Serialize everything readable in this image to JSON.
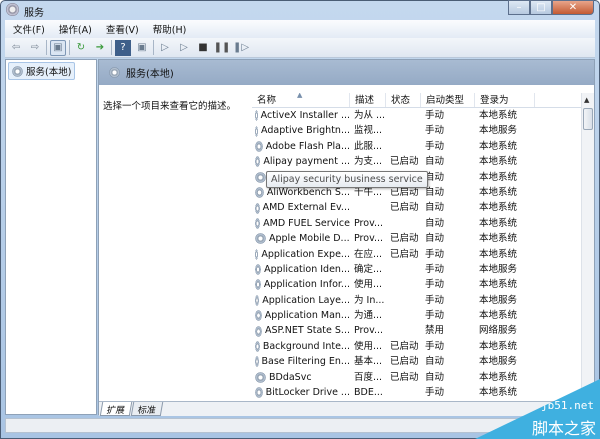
{
  "window": {
    "title": "服务",
    "controls": [
      "minimize",
      "maximize",
      "close"
    ]
  },
  "menu": [
    "文件(F)",
    "操作(A)",
    "查看(V)",
    "帮助(H)"
  ],
  "toolbar": [
    "back-icon",
    "forward-icon",
    "console-tree-icon",
    "refresh-icon",
    "export-icon",
    "help-icon",
    "properties-icon",
    "start-icon",
    "start-alt-icon",
    "stop-icon",
    "pause-icon",
    "restart-icon"
  ],
  "tree": {
    "root": "服务(本地)"
  },
  "panel": {
    "title": "服务(本地)",
    "description": "选择一个项目来查看它的描述。"
  },
  "columns": [
    "名称",
    "描述",
    "状态",
    "启动类型",
    "登录为"
  ],
  "rows": [
    [
      "ActiveX Installer ...",
      "为从 ...",
      "",
      "手动",
      "本地系统"
    ],
    [
      "Adaptive Brightn...",
      "监视...",
      "",
      "手动",
      "本地服务"
    ],
    [
      "Adobe Flash Pla...",
      "此服...",
      "",
      "手动",
      "本地系统"
    ],
    [
      "Alipay payment ...",
      "为支...",
      "已启动",
      "自动",
      "本地系统"
    ],
    [
      "",
      "",
      "已启动",
      "自动",
      "本地系统"
    ],
    [
      "AliWorkbench S...",
      "千牛...",
      "已启动",
      "自动",
      "本地系统"
    ],
    [
      "AMD External Ev...",
      "",
      "已启动",
      "自动",
      "本地系统"
    ],
    [
      "AMD FUEL Service",
      "Prov...",
      "",
      "自动",
      "本地系统"
    ],
    [
      "Apple Mobile D...",
      "Prov...",
      "已启动",
      "自动",
      "本地系统"
    ],
    [
      "Application Expe...",
      "在应...",
      "已启动",
      "手动",
      "本地系统"
    ],
    [
      "Application Iden...",
      "确定...",
      "",
      "手动",
      "本地服务"
    ],
    [
      "Application Infor...",
      "使用...",
      "",
      "手动",
      "本地系统"
    ],
    [
      "Application Laye...",
      "为 In...",
      "",
      "手动",
      "本地服务"
    ],
    [
      "Application Man...",
      "为通...",
      "",
      "手动",
      "本地系统"
    ],
    [
      "ASP.NET State S...",
      "Prov...",
      "",
      "禁用",
      "网络服务"
    ],
    [
      "Background Inte...",
      "使用...",
      "已启动",
      "手动",
      "本地系统"
    ],
    [
      "Base Filtering En...",
      "基本...",
      "已启动",
      "自动",
      "本地服务"
    ],
    [
      "BDdaSvc",
      "百度...",
      "已启动",
      "自动",
      "本地系统"
    ],
    [
      "BitLocker Drive ...",
      "BDE...",
      "",
      "手动",
      "本地系统"
    ]
  ],
  "tooltip": "Alipay security business service",
  "tabs": [
    "扩展",
    "标准"
  ],
  "watermark": {
    "site": "jb51.net",
    "name": "脚本之家"
  }
}
